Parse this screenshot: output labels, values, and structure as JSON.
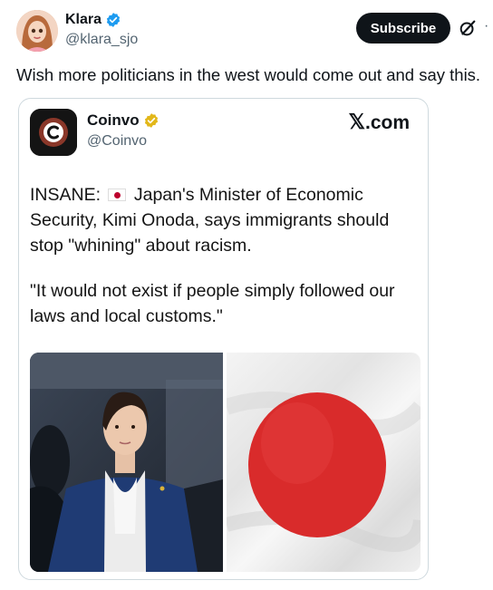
{
  "post": {
    "author_name": "Klara",
    "author_handle": "@klara_sjo",
    "subscribe_label": "Subscribe",
    "more_label": "·",
    "text": "Wish more politicians in the west would come out and say this."
  },
  "quoted": {
    "name": "Coinvo",
    "handle": "@Coinvo",
    "site": ".com",
    "site_glyph": "𝕏",
    "line1_prefix": "INSANE: ",
    "line1_suffix": " Japan's Minister of Economic Security, Kimi Onoda, says immigrants should stop \"whining\" about racism.",
    "quote": "\"It would not exist if people simply followed our laws and local customs.\""
  },
  "colors": {
    "accent": "#1d9bf0",
    "gold": "#e2b719",
    "flag_red": "#d92b2b"
  },
  "icons": {
    "verified": "verified-badge-icon",
    "gold_verified": "gold-verified-badge-icon",
    "grok": "grok-icon",
    "x_logo": "x-logo-icon"
  }
}
